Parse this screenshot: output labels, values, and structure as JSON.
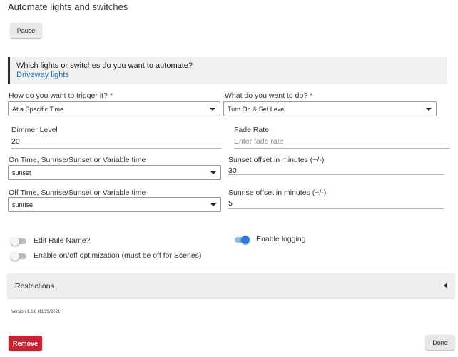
{
  "page": {
    "title": "Automate lights and switches"
  },
  "actions": {
    "pause_label": "Pause",
    "remove_label": "Remove",
    "done_label": "Done"
  },
  "devices": {
    "question": "Which lights or switches do you want to automate?",
    "selected": "Driveway lights"
  },
  "trigger": {
    "label": "How do you want to trigger it? *",
    "value": "At a Specific Time"
  },
  "action": {
    "label": "What do you want to do? *",
    "value": "Turn On & Set Level"
  },
  "dimmer": {
    "label": "Dimmer Level",
    "value": "20"
  },
  "fade": {
    "label": "Fade Rate",
    "placeholder": "Enter fade rate",
    "value": ""
  },
  "on_time": {
    "label": "On Time, Sunrise/Sunset or Variable time",
    "value": "sunset"
  },
  "sunset_offset": {
    "label": "Sunset offset in minutes (+/-)",
    "value": "30"
  },
  "off_time": {
    "label": "Off Time, Sunrise/Sunset or Variable time",
    "value": "sunrise"
  },
  "sunrise_offset": {
    "label": "Sunrise offset in minutes (+/-)",
    "value": "5"
  },
  "toggles": {
    "edit_rule_name": {
      "label": "Edit Rule Name?",
      "on": false
    },
    "enable_logging": {
      "label": "Enable logging",
      "on": true
    },
    "onoff_optimization": {
      "label": "Enable on/off optimization (must be off for Scenes)",
      "on": false
    }
  },
  "restrictions": {
    "label": "Restrictions"
  },
  "footer": {
    "version": "Version 1.3.8 (11/29/2021)"
  },
  "colors": {
    "accent": "#1f6fc0",
    "danger": "#c62232",
    "toggle_on": "#2f7bd0",
    "toggle_on_track": "#8fb8e6"
  },
  "icons": {
    "select_caret": "caret-down-icon",
    "collapse": "caret-left-icon"
  }
}
